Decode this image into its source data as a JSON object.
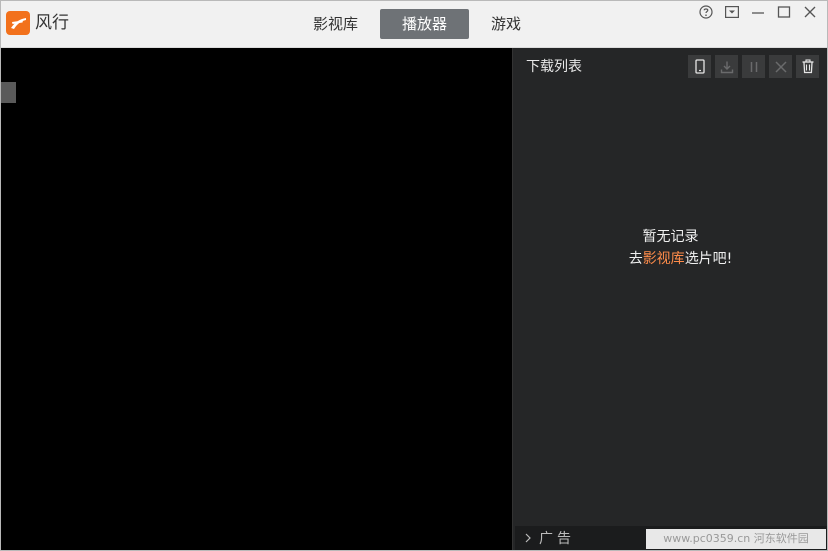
{
  "app": {
    "title": "风行",
    "brand_color": "#f2711c"
  },
  "tabs": [
    {
      "label": "影视库",
      "active": false
    },
    {
      "label": "播放器",
      "active": true
    },
    {
      "label": "游戏",
      "active": false
    }
  ],
  "window_controls": [
    "help-icon",
    "menu-dropdown-icon",
    "minimize-icon",
    "maximize-icon",
    "close-icon"
  ],
  "download_panel": {
    "title": "下载列表",
    "tools": [
      "phone-icon",
      "download-icon",
      "pause-icon",
      "cancel-icon",
      "trash-icon"
    ],
    "empty": {
      "line1": "暂无记录",
      "line2_prefix": "去",
      "line2_link": "影视库",
      "line2_suffix": "选片吧!"
    },
    "ad_label": "广告",
    "watermark": "www.pc0359.cn 河东软件园"
  }
}
